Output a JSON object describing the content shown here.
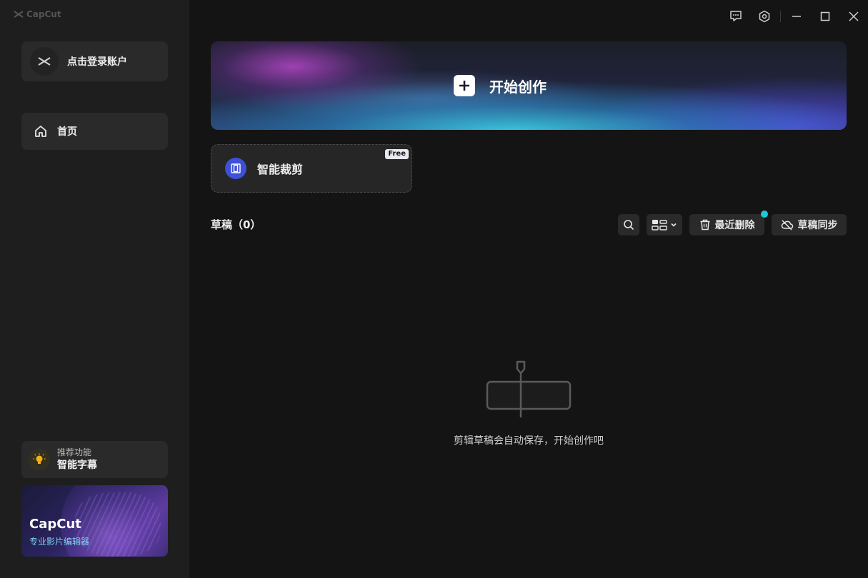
{
  "app": {
    "name": "CapCut"
  },
  "sidebar": {
    "login_label": "点击登录账户",
    "nav": [
      {
        "label": "首页",
        "icon": "home-icon"
      }
    ],
    "feature": {
      "sub": "推荐功能",
      "title": "智能字幕",
      "icon": "lightbulb-icon",
      "icon_color": "#f2b01e"
    },
    "promo": {
      "title": "CapCut",
      "subtitle": "专业影片编辑器"
    }
  },
  "titlebar": {
    "icons": [
      "feedback-icon",
      "settings-hexagon-icon",
      "minimize-icon",
      "maximize-icon",
      "close-icon"
    ]
  },
  "main": {
    "create_label": "开始创作",
    "smart_crop": {
      "label": "智能裁剪",
      "badge": "Free",
      "icon_color": "#3d50d8"
    },
    "drafts": {
      "title": "草稿（0）",
      "recent_delete_label": "最近删除",
      "sync_label": "草稿同步",
      "empty_text": "剪辑草稿会自动保存，开始创作吧"
    }
  },
  "colors": {
    "accent_dot": "#1ec6d8",
    "background": "#141414",
    "sidebar": "#1e1e1e"
  }
}
